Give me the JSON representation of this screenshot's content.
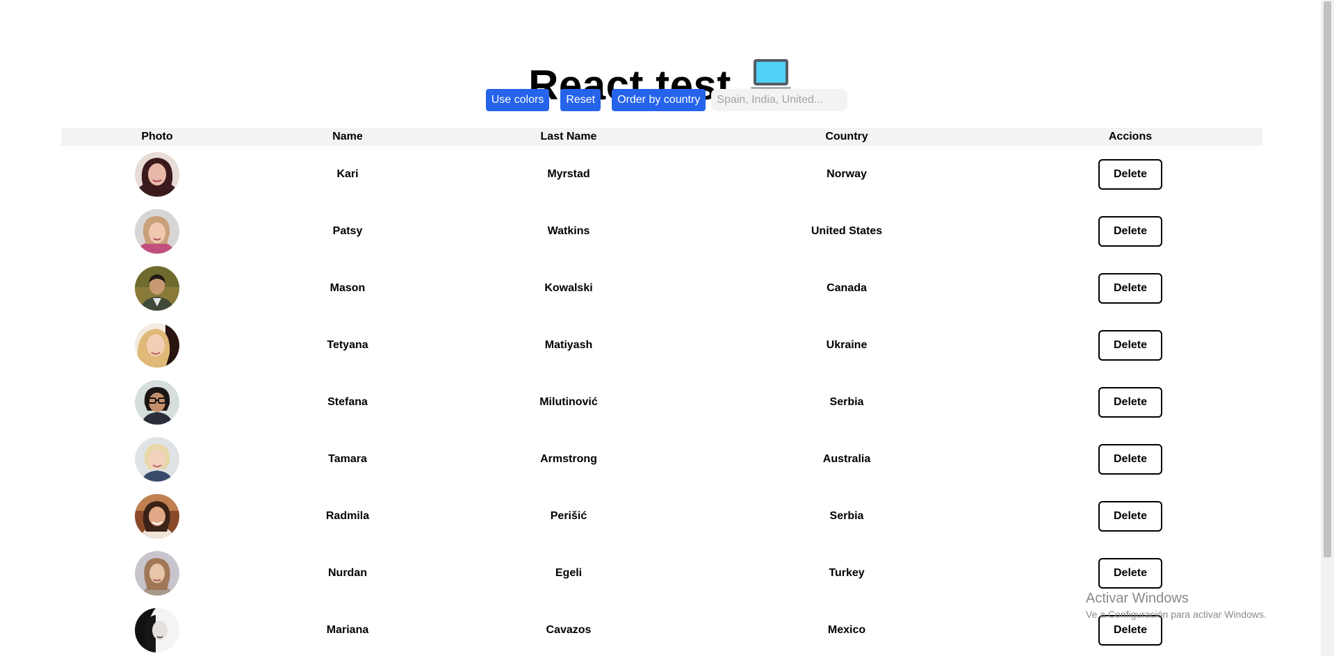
{
  "header": {
    "title": "React test",
    "icon": "laptop-icon"
  },
  "controls": {
    "use_colors_label": "Use colors",
    "reset_label": "Reset",
    "order_by_country_label": "Order by country",
    "search_placeholder": "Spain, India, United...",
    "accent_color": "#2563eb"
  },
  "table": {
    "columns": [
      "Photo",
      "Name",
      "Last Name",
      "Country",
      "Accions"
    ],
    "delete_label": "Delete",
    "rows": [
      {
        "name": "Kari",
        "last_name": "Myrstad",
        "country": "Norway"
      },
      {
        "name": "Patsy",
        "last_name": "Watkins",
        "country": "United States"
      },
      {
        "name": "Mason",
        "last_name": "Kowalski",
        "country": "Canada"
      },
      {
        "name": "Tetyana",
        "last_name": "Matiyash",
        "country": "Ukraine"
      },
      {
        "name": "Stefana",
        "last_name": "Milutinović",
        "country": "Serbia"
      },
      {
        "name": "Tamara",
        "last_name": "Armstrong",
        "country": "Australia"
      },
      {
        "name": "Radmila",
        "last_name": "Perišić",
        "country": "Serbia"
      },
      {
        "name": "Nurdan",
        "last_name": "Egeli",
        "country": "Turkey"
      },
      {
        "name": "Mariana",
        "last_name": "Cavazos",
        "country": "Mexico"
      }
    ]
  },
  "watermark": {
    "title": "Activar Windows",
    "subtitle": "Ve a Configuración para activar Windows."
  }
}
